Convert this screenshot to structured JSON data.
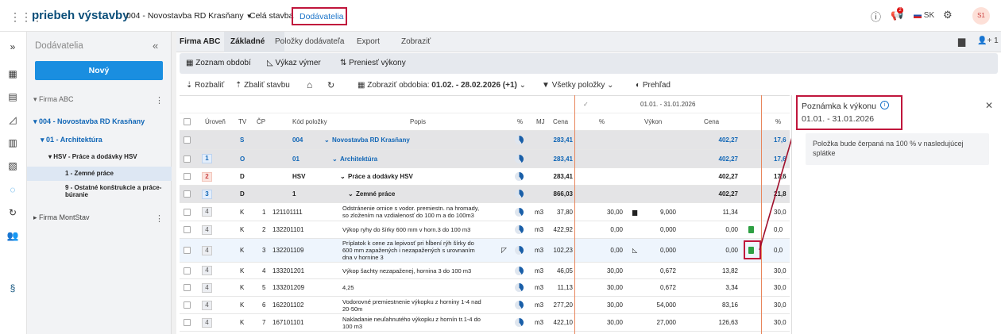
{
  "app": {
    "brand": "priebeh výstavby",
    "project": "004 - Novostavba RD Krasňany",
    "nav_whole": "Celá stavba",
    "nav_suppliers": "Dodávatelia",
    "lang": "SK",
    "avatar": "S1",
    "notif_count": "2"
  },
  "sidebar": {
    "title": "Dodávatelia",
    "new_button": "Nový",
    "items": [
      {
        "label": "Firma ABC"
      },
      {
        "label": "004 - Novostavba RD Krasňany"
      },
      {
        "label": "01 - Architektúra"
      },
      {
        "label": "HSV - Práce a dodávky HSV"
      },
      {
        "label": "1 - Zemné práce"
      },
      {
        "label": "9 - Ostatné konštrukcie a práce-búranie"
      },
      {
        "label": "Firma MontStav"
      }
    ]
  },
  "tabs": {
    "firm": "Firma ABC",
    "items": [
      "Základné",
      "Položky dodávateľa",
      "Export",
      "Zobraziť"
    ],
    "follow_count": "1"
  },
  "toolbar1": {
    "periods": "Zoznam období",
    "report": "Výkaz výmer",
    "transfer": "Preniesť výkony"
  },
  "toolbar2": {
    "expand": "Rozbaliť",
    "collapse": "Zbaliť stavbu",
    "period_label": "Zobraziť obdobia:",
    "period_value": "01.02. - 28.02.2026 (+1)",
    "filter": "Všetky položky",
    "overview": "Prehľad"
  },
  "grid": {
    "headers": {
      "level": "Úroveň",
      "tv": "TV",
      "cp": "ČP",
      "code": "Kód položky",
      "desc": "Popis",
      "pct": "%",
      "unit": "MJ",
      "price": "Cena",
      "period": "01.01. - 31.01.2026",
      "p_pct": "%",
      "p_perf": "Výkon",
      "p_price": "Cena",
      "r_pct": "%"
    },
    "rows": [
      {
        "lvl": "",
        "tv": "S",
        "cp": "",
        "code": "004",
        "desc": "Novostavba RD Krasňany",
        "unit": "",
        "price": "283,41",
        "pp": "",
        "perf": "",
        "pprice": "402,27",
        "r": "17,6"
      },
      {
        "lvl": "1",
        "tv": "O",
        "cp": "",
        "code": "01",
        "desc": "Architektúra",
        "unit": "",
        "price": "283,41",
        "pp": "",
        "perf": "",
        "pprice": "402,27",
        "r": "17,6"
      },
      {
        "lvl": "2",
        "tv": "D",
        "cp": "",
        "code": "HSV",
        "desc": "Práce a dodávky HSV",
        "unit": "",
        "price": "283,41",
        "pp": "",
        "perf": "",
        "pprice": "402,27",
        "r": "17,6"
      },
      {
        "lvl": "3",
        "tv": "D",
        "cp": "",
        "code": "1",
        "desc": "Zemné práce",
        "unit": "",
        "price": "866,03",
        "pp": "",
        "perf": "",
        "pprice": "402,27",
        "r": "21,8"
      },
      {
        "lvl": "4",
        "tv": "K",
        "cp": "1",
        "code": "121101111",
        "desc": "Odstránenie ornice s vodor. premiestn. na hromady, so zložením na vzdialenosť do 100 m a do 100m3",
        "unit": "m3",
        "price": "37,80",
        "pp": "30,00",
        "perf": "9,000",
        "pprice": "11,34",
        "r": "30,0"
      },
      {
        "lvl": "4",
        "tv": "K",
        "cp": "2",
        "code": "132201101",
        "desc": "Výkop ryhy do šírky 600 mm v horn.3 do 100 m3",
        "unit": "m3",
        "price": "422,92",
        "pp": "0,00",
        "perf": "0,000",
        "pprice": "0,00",
        "r": "0,0"
      },
      {
        "lvl": "4",
        "tv": "K",
        "cp": "3",
        "code": "132201109",
        "desc": "Príplatok k cene za lepivosť pri hĺbení rýh šírky do 600 mm zapažených i nezapažených s urovnaním dna v hornine 3",
        "unit": "m3",
        "price": "102,23",
        "pp": "0,00",
        "perf": "0,000",
        "pprice": "0,00",
        "r": "0,0"
      },
      {
        "lvl": "4",
        "tv": "K",
        "cp": "4",
        "code": "133201201",
        "desc": "Výkop šachty nezapaženej, hornina 3 do 100 m3",
        "unit": "m3",
        "price": "46,05",
        "pp": "30,00",
        "perf": "0,672",
        "pprice": "13,82",
        "r": "30,0"
      },
      {
        "lvl": "4",
        "tv": "K",
        "cp": "5",
        "code": "133201209",
        "desc": "4,25",
        "unit": "m3",
        "price": "11,13",
        "pp": "30,00",
        "perf": "0,672",
        "pprice": "3,34",
        "r": "30,0"
      },
      {
        "lvl": "4",
        "tv": "K",
        "cp": "6",
        "code": "162201102",
        "desc": "Vodorovné premiestnenie výkopku z horniny 1-4 nad 20-50m",
        "unit": "m3",
        "price": "277,20",
        "pp": "30,00",
        "perf": "54,000",
        "pprice": "83,16",
        "r": "30,0"
      },
      {
        "lvl": "4",
        "tv": "K",
        "cp": "7",
        "code": "167101101",
        "desc": "Nakladanie neuľahnutého výkopku z hornín tr.1-4 do 100 m3",
        "unit": "m3",
        "price": "422,10",
        "pp": "30,00",
        "perf": "27,000",
        "pprice": "126,63",
        "r": "30,0"
      }
    ]
  },
  "note_panel": {
    "title": "Poznámka k výkonu",
    "period": "01.01. - 31.01.2026",
    "text": "Položka bude čerpaná na 100 % v nasledujúcej splátke"
  }
}
